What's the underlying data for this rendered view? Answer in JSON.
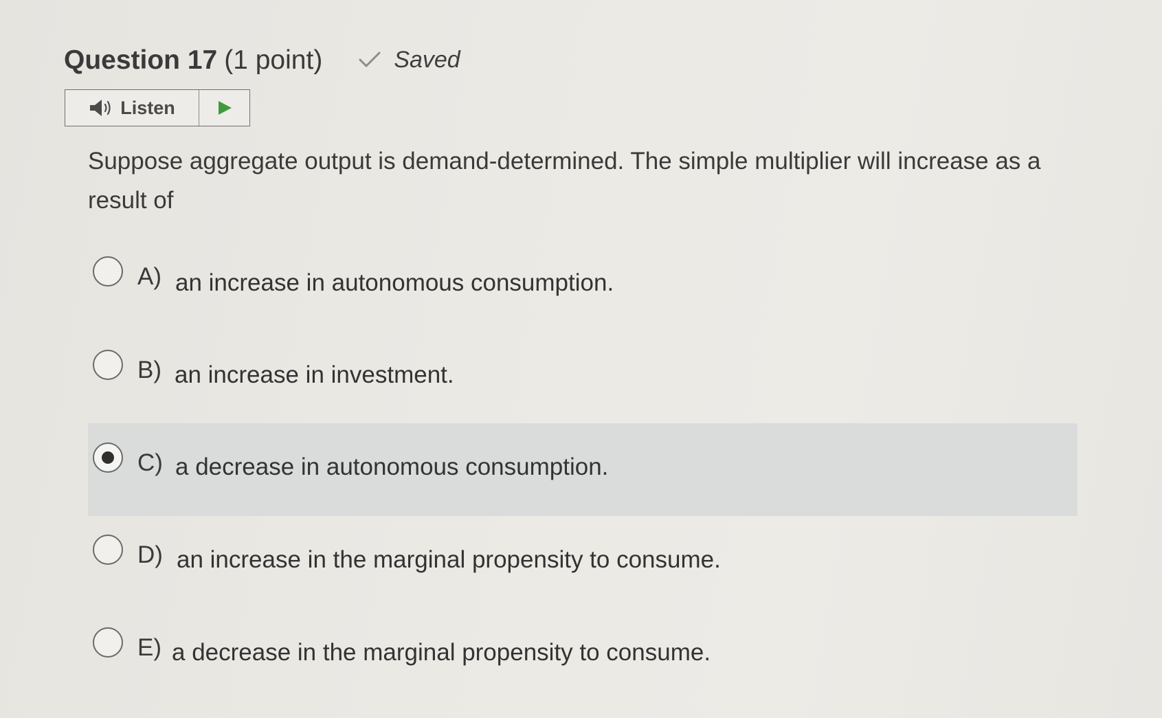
{
  "question": {
    "title": "Question 17",
    "points": "(1 point)",
    "status": "Saved",
    "text": "Suppose aggregate output is demand-determined. The simple multiplier will increase as a result of"
  },
  "listen": {
    "label": "Listen"
  },
  "options": [
    {
      "letter": "A)",
      "text": "an increase in autonomous consumption.",
      "selected": false
    },
    {
      "letter": "B)",
      "text": "an increase in investment.",
      "selected": false
    },
    {
      "letter": "C)",
      "text": "a decrease in autonomous consumption.",
      "selected": true
    },
    {
      "letter": "D)",
      "text": "an increase in the marginal propensity to consume.",
      "selected": false
    },
    {
      "letter": "E)",
      "text": "a decrease in the marginal propensity to consume.",
      "selected": false
    }
  ],
  "colors": {
    "play_green": "#3f9a3c",
    "selected_bg": "#dadcdc"
  },
  "icons": {
    "status": "checkmark-icon",
    "listen": "speaker-icon",
    "play": "play-icon"
  }
}
